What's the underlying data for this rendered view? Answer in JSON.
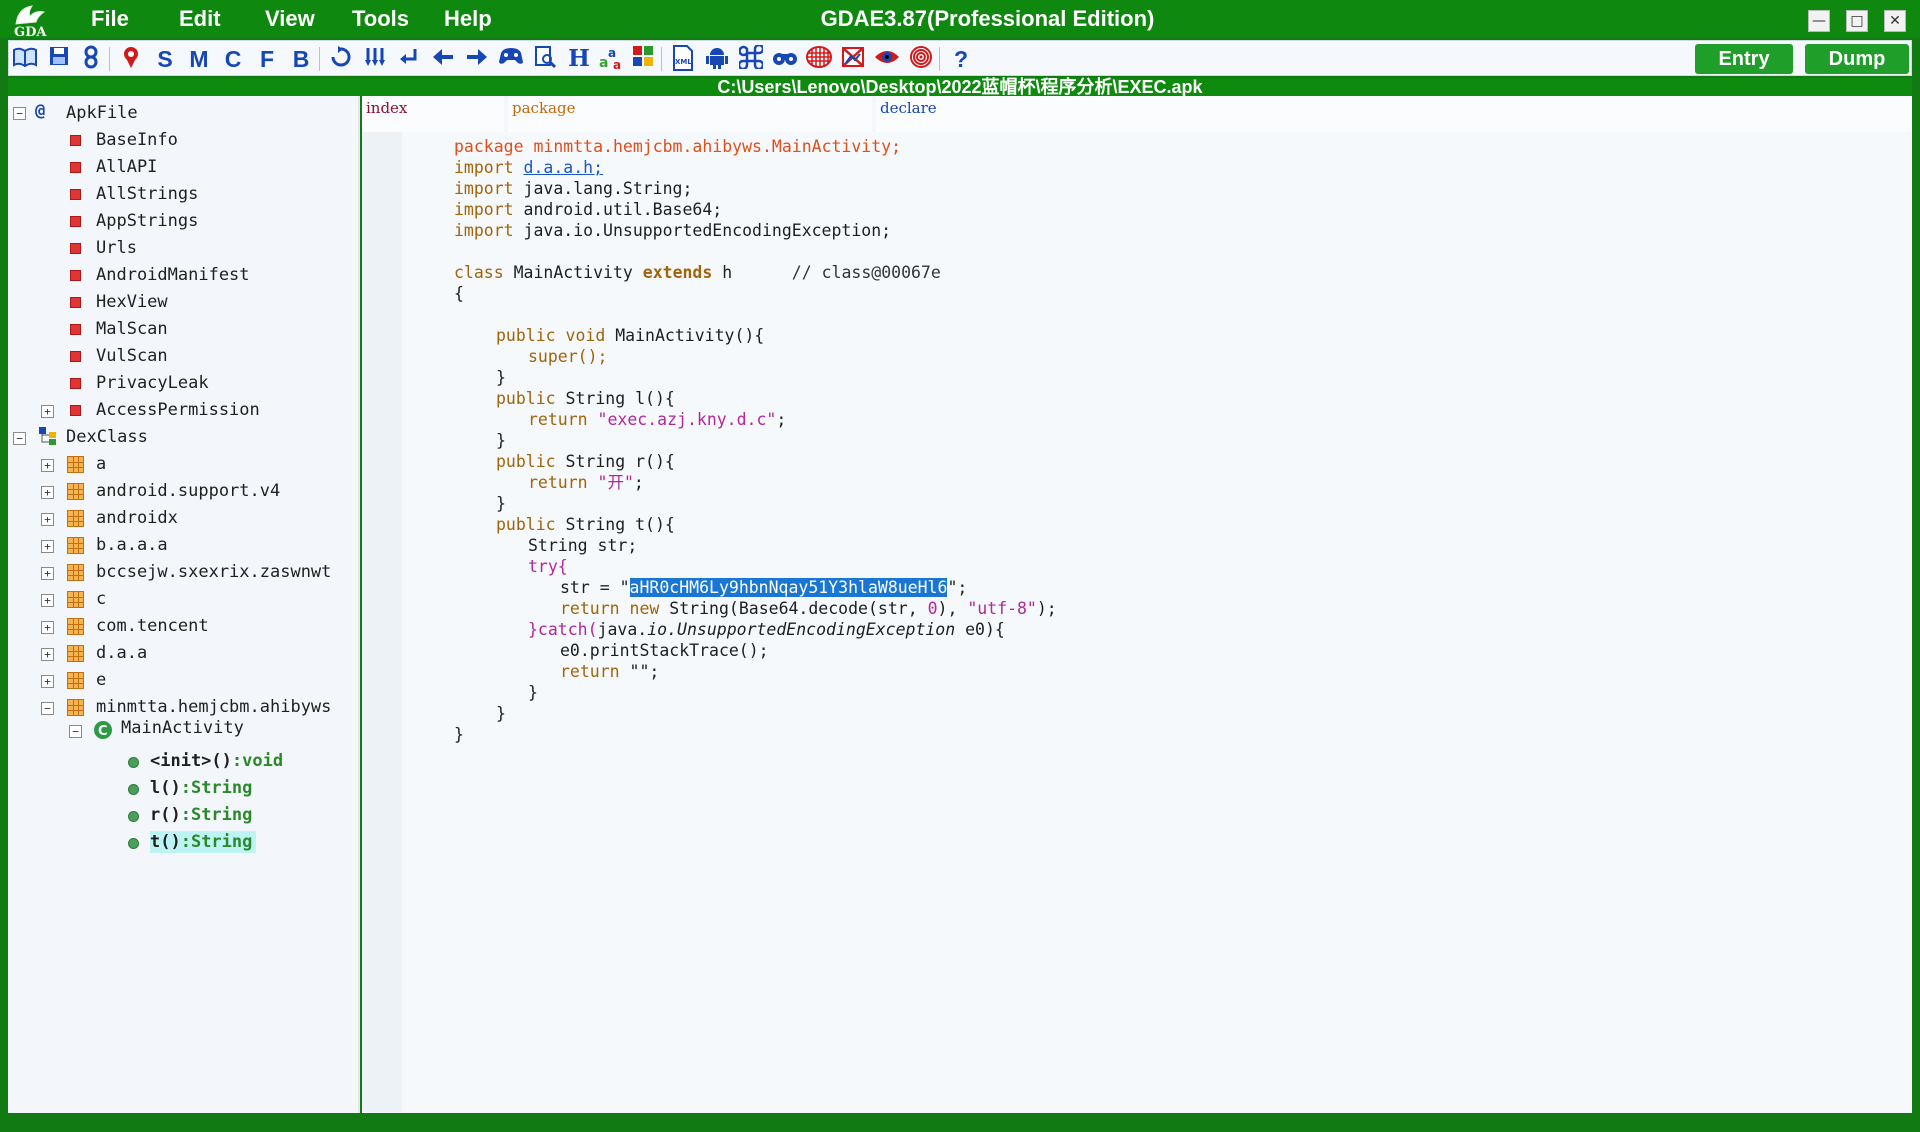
{
  "app": {
    "title": "GDAE3.87(Professional Edition)",
    "logo_text": "GDA",
    "menu": [
      "File",
      "Edit",
      "View",
      "Tools",
      "Help"
    ],
    "window_controls": {
      "minimize": "—",
      "maximize": "□",
      "close": "✕"
    }
  },
  "toolbar": {
    "letters": [
      "S",
      "M",
      "C",
      "F",
      "B",
      "H"
    ],
    "entry_label": "Entry",
    "dump_label": "Dump",
    "help_label": "?"
  },
  "path": "C:\\Users\\Lenovo\\Desktop\\2022蓝帽杯\\程序分析\\EXEC.apk",
  "tree": {
    "apk_root": "ApkFile",
    "apk_items": [
      "BaseInfo",
      "AllAPI",
      "AllStrings",
      "AppStrings",
      "Urls",
      "AndroidManifest",
      "HexView",
      "MalScan",
      "VulScan",
      "PrivacyLeak",
      "AccessPermission"
    ],
    "dex_root": "DexClass",
    "packages": [
      "a",
      "android.support.v4",
      "androidx",
      "b.a.a.a",
      "bccsejw.sxexrix.zaswnwt",
      "c",
      "com.tencent",
      "d.a.a",
      "e",
      "minmtta.hemjcbm.ahibyws"
    ],
    "class_name": "MainActivity",
    "methods": [
      {
        "name": "<init>()",
        "ret": ":void"
      },
      {
        "name": "l()",
        "ret": ":String"
      },
      {
        "name": "r()",
        "ret": ":String"
      },
      {
        "name": "t()",
        "ret": ":String"
      }
    ]
  },
  "headers": {
    "index": "index",
    "package": "package",
    "declare": "declare"
  },
  "code": {
    "kw_package": "package",
    "package_name": "minmtta.hemjcbm.ahibyws.MainActivity;",
    "kw_import": "import",
    "import_link": "d.a.a.h;",
    "import_2": "java.lang.String;",
    "import_3": "android.util.Base64;",
    "import_4": "java.io.UnsupportedEncodingException;",
    "kw_class": "class",
    "class_name": "MainActivity",
    "kw_extends": "extends",
    "super_class": "h",
    "comment": "// class@00067e",
    "open_brace": "{",
    "close_brace": "}",
    "m1_sig": "MainActivity(){",
    "super_call": "super();",
    "kw_public": "public",
    "kw_void": "void",
    "type_string": "String",
    "m_l": "l(){",
    "m_r": "r(){",
    "m_t": "t(){",
    "kw_return": "return",
    "str_l": "\"exec.azj.kny.d.c\"",
    "str_r": "\"开\"",
    "decl_str": "String str;",
    "kw_try": "try{",
    "assign_prefix": "str = \"",
    "b64": "aHR0cHM6Ly9hbnNqay51Y3hlaW8ueHl6",
    "assign_suffix": "\";",
    "kw_new": "new",
    "decode_call": "String(Base64.decode(str, ",
    "zero": "0",
    "decode_end": "), ",
    "utf8": "\"utf-8\"",
    "stmt_end": ");",
    "catch_open": "}catch(",
    "catch_pkg": "java.",
    "catch_io": "io.",
    "catch_type": "UnsupportedEncodingException",
    "catch_var": "e0){",
    "print_trace": "e0.printStackTrace();",
    "empty_str": "\"\"",
    "semicolon": ";"
  }
}
